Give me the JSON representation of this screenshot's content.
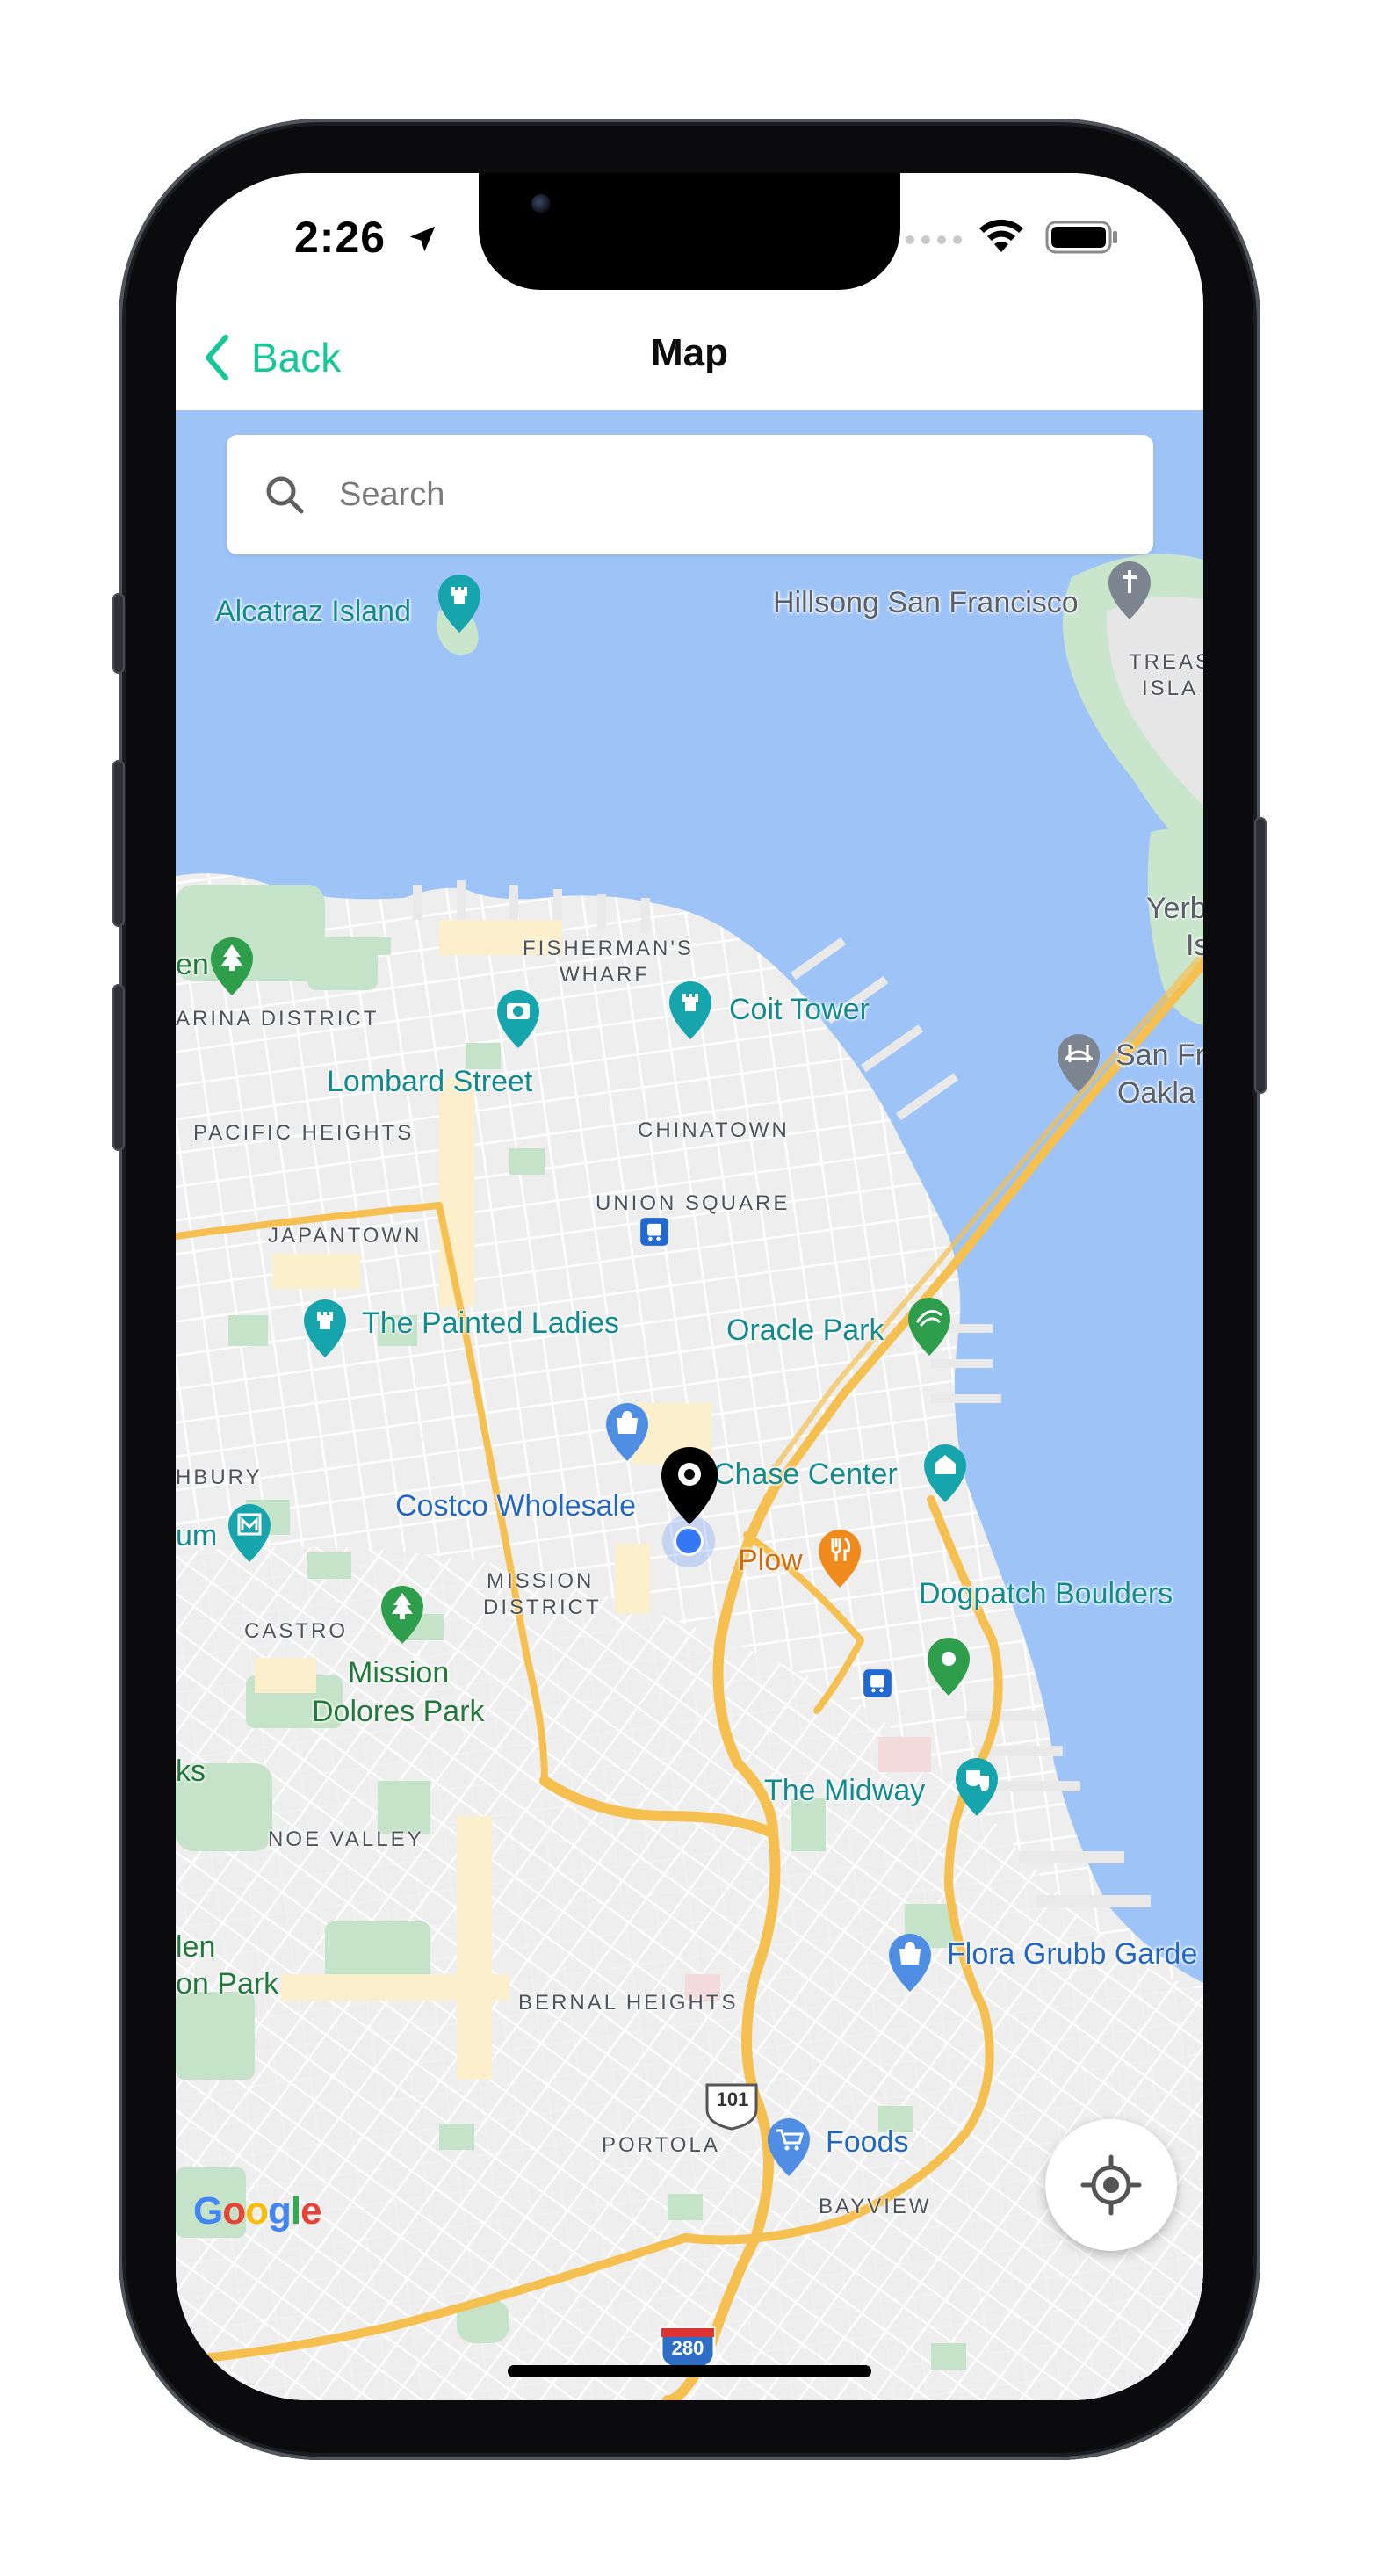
{
  "status_bar": {
    "time": "2:26",
    "location_icon": "location-arrow-icon",
    "signal_icon": "signal-dots-icon",
    "wifi_icon": "wifi-icon",
    "battery_icon": "battery-icon"
  },
  "nav": {
    "back_label": "Back",
    "title": "Map",
    "accent_color": "#16c79a"
  },
  "search": {
    "placeholder": "Search",
    "value": ""
  },
  "map": {
    "places": {
      "alcatraz": "Alcatraz Island",
      "hillsong": "Hillsong San Francisco",
      "treasure_island_1": "TREAS",
      "treasure_island_2": "ISLA",
      "yerba_buena_1": "Yerb",
      "yerba_buena_2": "Is",
      "fishermans_wharf_1": "FISHERMAN'S",
      "fishermans_wharf_2": "WHARF",
      "marina_district": "ARINA DISTRICT",
      "coit_tower": "Coit Tower",
      "lombard_street": "Lombard Street",
      "sf_oakland_1": "San Fr",
      "sf_oakland_2": "Oakla",
      "pacific_heights": "PACIFIC HEIGHTS",
      "chinatown": "CHINATOWN",
      "union_square": "UNION SQUARE",
      "japantown": "JAPANTOWN",
      "oracle_park": "Oracle Park",
      "painted_ladies": "The Painted Ladies",
      "haight_ashbury": "HBURY",
      "chase_center": "Chase Center",
      "costco": "Costco Wholesale",
      "museum_partial": "um",
      "mission_district_1": "MISSION",
      "mission_district_2": "DISTRICT",
      "plow": "Plow",
      "dogpatch_boulders": "Dogpatch Boulders",
      "castro": "CASTRO",
      "mission_dolores_1": "Mission",
      "mission_dolores_2": "Dolores Park",
      "twin_peaks_partial": "ks",
      "the_midway": "The Midway",
      "noe_valley": "NOE VALLEY",
      "highway_101": "101",
      "flora_grubb": "Flora Grubb Garde",
      "glen_park_1": "len",
      "glen_park_2": "on Park",
      "bernal_heights": "BERNAL HEIGHTS",
      "highway_280": "280",
      "portola": "PORTOLA",
      "foods": "Foods",
      "bayview": "BAYVIEW",
      "golden_gate_partial": "en"
    },
    "google_logo": "Google",
    "colors": {
      "water": "#9dc3f7",
      "land": "#efefef",
      "park": "#c8e6c9",
      "highway": "#f7c55c"
    }
  },
  "my_location_button": {
    "icon": "crosshair-icon"
  }
}
